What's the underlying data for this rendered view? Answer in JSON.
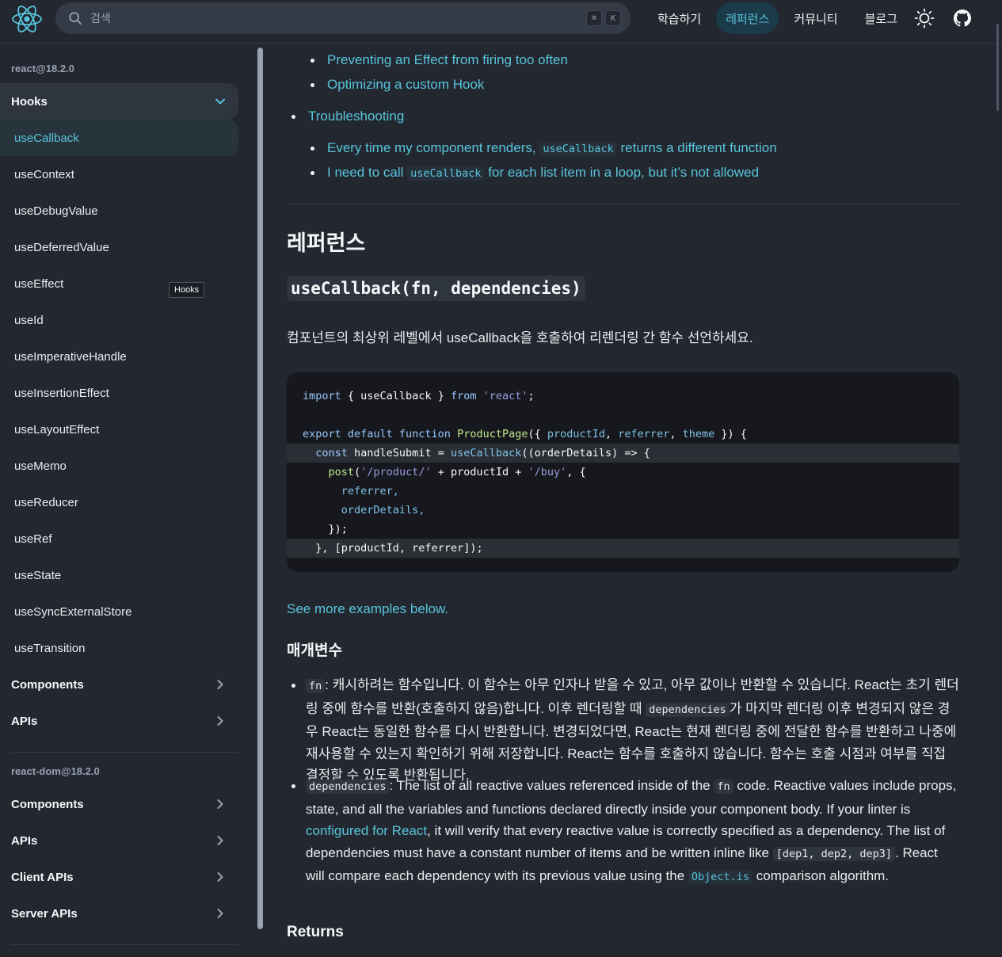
{
  "header": {
    "search_placeholder": "검색",
    "kbd": [
      "⌘",
      "K"
    ],
    "nav": [
      {
        "label": "학습하기",
        "active": false
      },
      {
        "label": "레퍼런스",
        "active": true
      },
      {
        "label": "커뮤니티",
        "active": false
      },
      {
        "label": "블로그",
        "active": false
      }
    ]
  },
  "colors": {
    "accent": "#58c4dc",
    "background": "#23272f",
    "code_bg": "#16181d"
  },
  "sidebar": {
    "react_pkg": "react@18.2.0",
    "hooks_section": "Hooks",
    "hooks": [
      "useCallback",
      "useContext",
      "useDebugValue",
      "useDeferredValue",
      "useEffect",
      "useId",
      "useImperativeHandle",
      "useInsertionEffect",
      "useLayoutEffect",
      "useMemo",
      "useReducer",
      "useRef",
      "useState",
      "useSyncExternalStore",
      "useTransition"
    ],
    "react_sections": [
      "Components",
      "APIs"
    ],
    "dom_pkg": "react-dom@18.2.0",
    "dom_sections": [
      "Components",
      "APIs",
      "Client APIs",
      "Server APIs"
    ],
    "tooltip": "Hooks"
  },
  "toc": {
    "prev_items": [
      "Preventing an Effect from firing too often",
      "Optimizing a custom Hook"
    ],
    "troubleshooting": "Troubleshooting",
    "ts1_pre": "Every time my component renders,",
    "ts1_code": "useCallback",
    "ts1_post": "returns a different function",
    "ts2_pre": "I need to call",
    "ts2_code": "useCallback",
    "ts2_post": "for each list item in a loop, but it’s not allowed"
  },
  "content": {
    "heading": "레퍼런스",
    "signature": "useCallback(fn, dependencies)",
    "intro": "컴포넌트의 최상위 레벨에서 useCallback을 호출하여 리렌더링 간 함수 선언하세요.",
    "see_more": "See more examples below.",
    "params_heading": "매개변수",
    "fn_code": "fn",
    "fn_text_1": ": 캐시하려는 함수입니다. 이 함수는 아무 인자나 받을 수 있고, 아무 값이나 반환할 수 있습니다. React는 초기 렌더링 중에 함수를 반환(호출하지 않음)합니다. 이후 렌더링할 때",
    "fn_code_2": "dependencies",
    "fn_text_2": "가 마지막 렌더링 이후 변경되지 않은 경우 React는 동일한 함수를 다시 반환합니다. 변경되었다면, React는 현재 렌더링 중에 전달한 함수를 반환하고 나중에 재사용할 수 있는지 확인하기 위해 저장합니다. React는 함수를 호출하지 않습니다. 함수는 호출 시점과 여부를 직접 결정할 수 있도록 반환됩니다.",
    "dep_code": "dependencies",
    "dep_text_1": ": The list of all reactive values referenced inside of the",
    "dep_code_2": "fn",
    "dep_text_2": "code. Reactive values include props, state, and all the variables and functions declared directly inside your component body. If your linter is",
    "dep_link": "configured for React",
    "dep_text_3": ", it will verify that every reactive value is correctly specified as a dependency. The list of dependencies must have a constant number of items and be written inline like",
    "dep_code_3": "[dep1, dep2, dep3]",
    "dep_text_4": ". React will compare each dependency with its previous value using the",
    "dep_code_4": "Object.is",
    "dep_text_5": "comparison algorithm.",
    "returns_heading": "Returns"
  },
  "code": {
    "l1_import": "import",
    "l1_mid": " { useCallback } ",
    "l1_from": "from",
    "l1_str": "'react'",
    "l1_end": ";",
    "l3_export": "export default function",
    "l3_fn": "ProductPage",
    "l3_open": "({ ",
    "l3_p1": "productId",
    "l3_p2": "referrer",
    "l3_p3": "theme",
    "l3_close": " }) {",
    "l4_const": "const",
    "l4_name": " handleSubmit = ",
    "l4_call": "useCallback",
    "l4_rest": "((orderDetails) => {",
    "l5_post": "post",
    "l5_s1": "'/product/'",
    "l5_mid": " + productId + ",
    "l5_s2": "'/buy'",
    "l5_end": ", {",
    "l6": "referrer,",
    "l7": "orderDetails,",
    "l8": "});",
    "l9": "}, [productId, referrer]);"
  }
}
